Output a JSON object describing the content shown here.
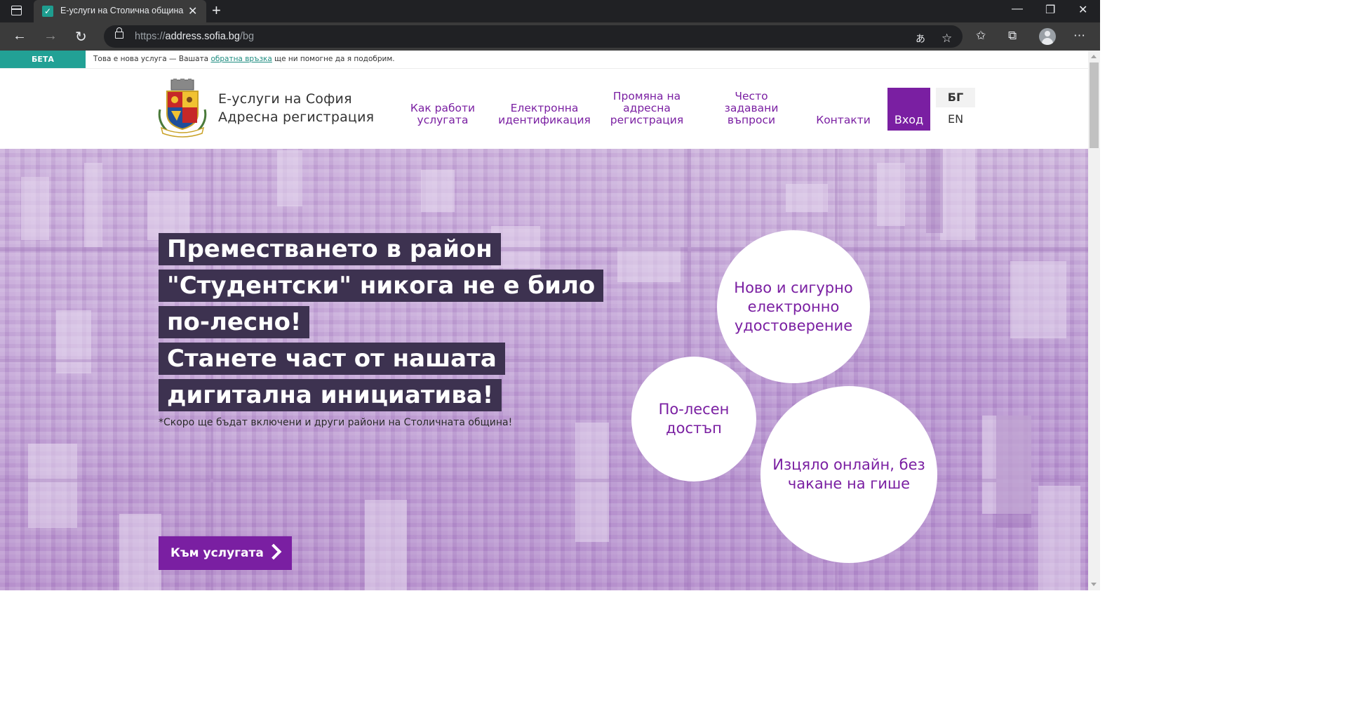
{
  "browser": {
    "tab_title": "Е-услуги на Столична община |",
    "url_scheme": "https://",
    "url_host": "address.sofia.bg",
    "url_path": "/bg"
  },
  "beta": {
    "tag": "БЕТА",
    "message_before": "Това е нова услуга — Вашата ",
    "feedback_link": "обратна връзка",
    "message_after": " ще ни помогне да я подобрим."
  },
  "header": {
    "brand_line1": "Е-услуги на София",
    "brand_line2": "Адресна регистрация",
    "nav": [
      {
        "label": "Как работи\nуслугата"
      },
      {
        "label": "Електронна\nидентификация"
      },
      {
        "label": "Промяна на\nадресна\nрегистрация"
      },
      {
        "label": "Често\nзадавани\nвъпроси"
      },
      {
        "label": "Контакти"
      }
    ],
    "login": "Вход",
    "lang_active": "БГ",
    "lang_other": "EN"
  },
  "hero": {
    "headline_lines": [
      "Преместването в район",
      "\"Студентски\" никога не е било",
      "по-лесно!",
      "Станете част от нашата",
      "дигитална инициатива!"
    ],
    "note": "*Скоро ще бъдат включени и други райони на Столичната община!",
    "bubbles": [
      "Ново и сигурно\nелектронно\nудостоверение",
      "По-лесен\nдостъп",
      "Изцяло онлайн, без\nчакане на гише"
    ],
    "cta": "Към услугата"
  },
  "colors": {
    "brand_purple": "#7a1fa2",
    "beta_teal": "#22a195",
    "headline_bg": "#3d3250"
  }
}
